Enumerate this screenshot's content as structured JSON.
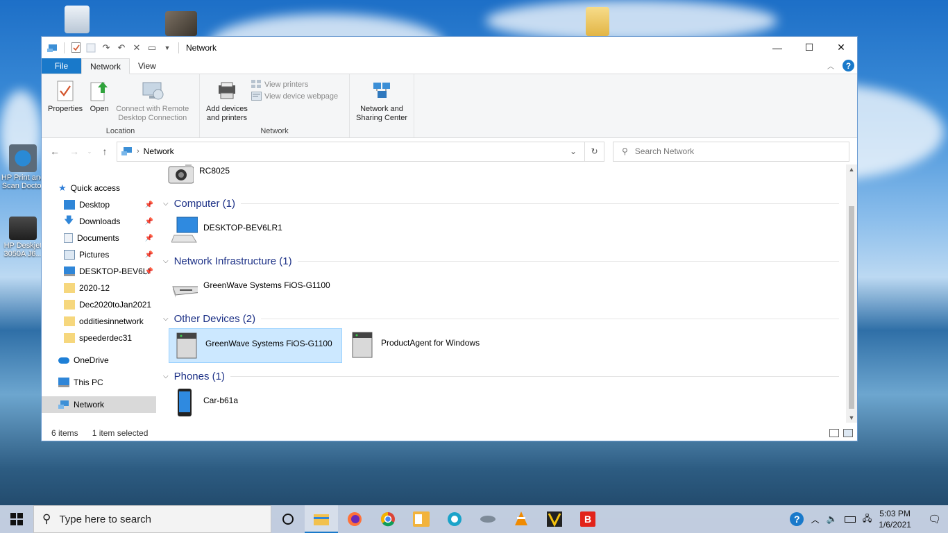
{
  "desktop": {
    "icons": [
      {
        "label": "",
        "icon": "recycle-bin-icon"
      },
      {
        "label": "",
        "icon": "cat-photo-icon"
      },
      {
        "label": "",
        "icon": "folder-icon"
      },
      {
        "label": "HP Print and Scan Doctor",
        "icon": "hp-print-scan-doctor-icon"
      },
      {
        "label": "HP Deskjet 3050A J6...",
        "icon": "printer-icon"
      }
    ]
  },
  "window": {
    "title": "Network",
    "quick_access_toolbar": [
      "properties-icon",
      "new-folder-icon",
      "redo-icon",
      "undo-icon",
      "delete-icon",
      "rename-icon",
      "customize-dropdown-icon"
    ],
    "controls": {
      "minimize": "—",
      "maximize": "☐",
      "close": "✕"
    }
  },
  "ribbon": {
    "tabs": [
      {
        "label": "File"
      },
      {
        "label": "Network"
      },
      {
        "label": "View"
      }
    ],
    "active_tab": "Network",
    "groups": {
      "location": {
        "label": "Location",
        "buttons": [
          {
            "label": "Properties",
            "icon": "properties-icon",
            "enabled": true
          },
          {
            "label": "Open",
            "icon": "open-icon",
            "enabled": true
          },
          {
            "label": "Connect with Remote Desktop Connection",
            "label_line1": "Connect with Remote",
            "label_line2": "Desktop Connection",
            "icon": "remote-desktop-icon",
            "enabled": false
          }
        ]
      },
      "network": {
        "label": "Network",
        "add_devices": {
          "label_line1": "Add devices",
          "label_line2": "and printers",
          "icon": "add-devices-icon"
        },
        "view_printers": {
          "label": "View printers",
          "icon": "printers-icon",
          "enabled": false
        },
        "view_device_webpage": {
          "label": "View device webpage",
          "icon": "webpage-icon",
          "enabled": false
        }
      },
      "sharing": {
        "label_line1": "Network and",
        "label_line2": "Sharing Center",
        "icon": "network-sharing-icon"
      }
    }
  },
  "address_bar": {
    "path": "Network",
    "search_placeholder": "Search Network"
  },
  "nav_pane": {
    "quick_access": {
      "label": "Quick access"
    },
    "pinned": [
      {
        "label": "Desktop",
        "icon": "desktop-folder-icon",
        "pinned": true
      },
      {
        "label": "Downloads",
        "icon": "downloads-icon",
        "pinned": true
      },
      {
        "label": "Documents",
        "icon": "documents-icon",
        "pinned": true
      },
      {
        "label": "Pictures",
        "icon": "pictures-icon",
        "pinned": true
      },
      {
        "label": "DESKTOP-BEV6LI",
        "icon": "computer-icon",
        "pinned": true
      },
      {
        "label": "2020-12",
        "icon": "folder-icon",
        "pinned": false
      },
      {
        "label": "Dec2020toJan2021",
        "icon": "folder-icon",
        "pinned": false
      },
      {
        "label": "odditiesinnetwork",
        "icon": "folder-icon",
        "pinned": false
      },
      {
        "label": "speederdec31",
        "icon": "folder-icon",
        "pinned": false
      }
    ],
    "onedrive": {
      "label": "OneDrive"
    },
    "this_pc": {
      "label": "This PC"
    },
    "network": {
      "label": "Network",
      "selected": true
    }
  },
  "content": {
    "partial_item": {
      "label": "RC8025"
    },
    "groups": [
      {
        "name": "Computer (1)",
        "items": [
          {
            "label": "DESKTOP-BEV6LR1",
            "icon": "computer-icon"
          }
        ]
      },
      {
        "name": "Network Infrastructure (1)",
        "items": [
          {
            "label": "GreenWave Systems FiOS-G1100",
            "icon": "router-icon"
          }
        ]
      },
      {
        "name": "Other Devices (2)",
        "items": [
          {
            "label": "GreenWave Systems FiOS-G1100",
            "icon": "device-icon",
            "selected": true
          },
          {
            "label": "ProductAgent for Windows",
            "icon": "device-icon",
            "selected": false
          }
        ]
      },
      {
        "name": "Phones (1)",
        "items": [
          {
            "label": "Car-b61a",
            "icon": "phone-icon"
          }
        ]
      }
    ]
  },
  "status_bar": {
    "item_count": "6 items",
    "selection": "1 item selected"
  },
  "taskbar": {
    "search_placeholder": "Type here to search",
    "apps": [
      "cortana-icon",
      "file-explorer-icon",
      "firefox-icon",
      "chrome-icon",
      "outlook-icon",
      "photos-app-icon",
      "drive-icon",
      "vlc-icon",
      "vectorize-icon",
      "bitdefender-icon"
    ],
    "tray": [
      "help-icon",
      "chevron-up-icon",
      "volume-icon",
      "battery-icon",
      "network-icon"
    ],
    "time": "5:03 PM",
    "date": "1/6/2021"
  },
  "colors": {
    "accent": "#1979ca",
    "selection": "#cce8ff",
    "group_heading": "#1e3287"
  }
}
